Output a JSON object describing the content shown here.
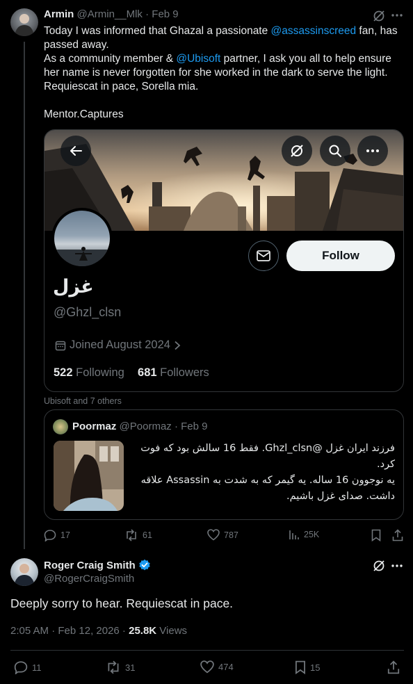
{
  "tweet": {
    "author_name": "Armin",
    "author_handle": "@Armin__Mlk",
    "sep": "·",
    "date": "Feb 9",
    "line1_a": "Today I was informed that Ghazal a passionate ",
    "mention1": "@assassinscreed",
    "line1_b": " fan, has passed away.",
    "line2_a": "As a community member & ",
    "mention2": "@Ubisoft",
    "line2_b": " partner, I ask you all to help ensure her name is never forgotten for she worked in the dark to serve the light. Requiescat in pace, Sorella mia.",
    "signature": "Mentor.Captures",
    "image_caption": "Ubisoft and 7 others",
    "actions": {
      "replies": "17",
      "reposts": "61",
      "likes": "787",
      "views": "25K"
    }
  },
  "profile_card": {
    "display_name": "غزل",
    "handle": "@Ghzl_clsn",
    "joined": "Joined August 2024",
    "following_count": "522",
    "following_label": "Following",
    "followers_count": "681",
    "followers_label": "Followers",
    "follow_label": "Follow"
  },
  "quote": {
    "author_name": "Poormaz",
    "author_handle": "@Poormaz",
    "sep": "·",
    "date": "Feb 9",
    "line1": "فرزند ایران غزل @Ghzl_clsn. فقط 16 سالش بود که فوت کرد.",
    "line2": "یه نوجوون 16 ساله. یه گیمر که به شدت به Assassin علاقه",
    "line3": "داشت.  صدای غزل باشیم."
  },
  "reply": {
    "author_name": "Roger Craig Smith",
    "author_handle": "@RogerCraigSmith",
    "text": "Deeply sorry to hear. Requiescat in pace.",
    "time": "2:05 AM · Feb 12, 2026 · ",
    "views_count": "25.8K",
    "views_label": " Views",
    "actions": {
      "replies": "11",
      "reposts": "31",
      "likes": "474",
      "bookmarks": "15"
    }
  },
  "colors": {
    "accent": "#1d9bf0",
    "muted": "#71767b",
    "border": "#333639",
    "background": "#000000"
  }
}
